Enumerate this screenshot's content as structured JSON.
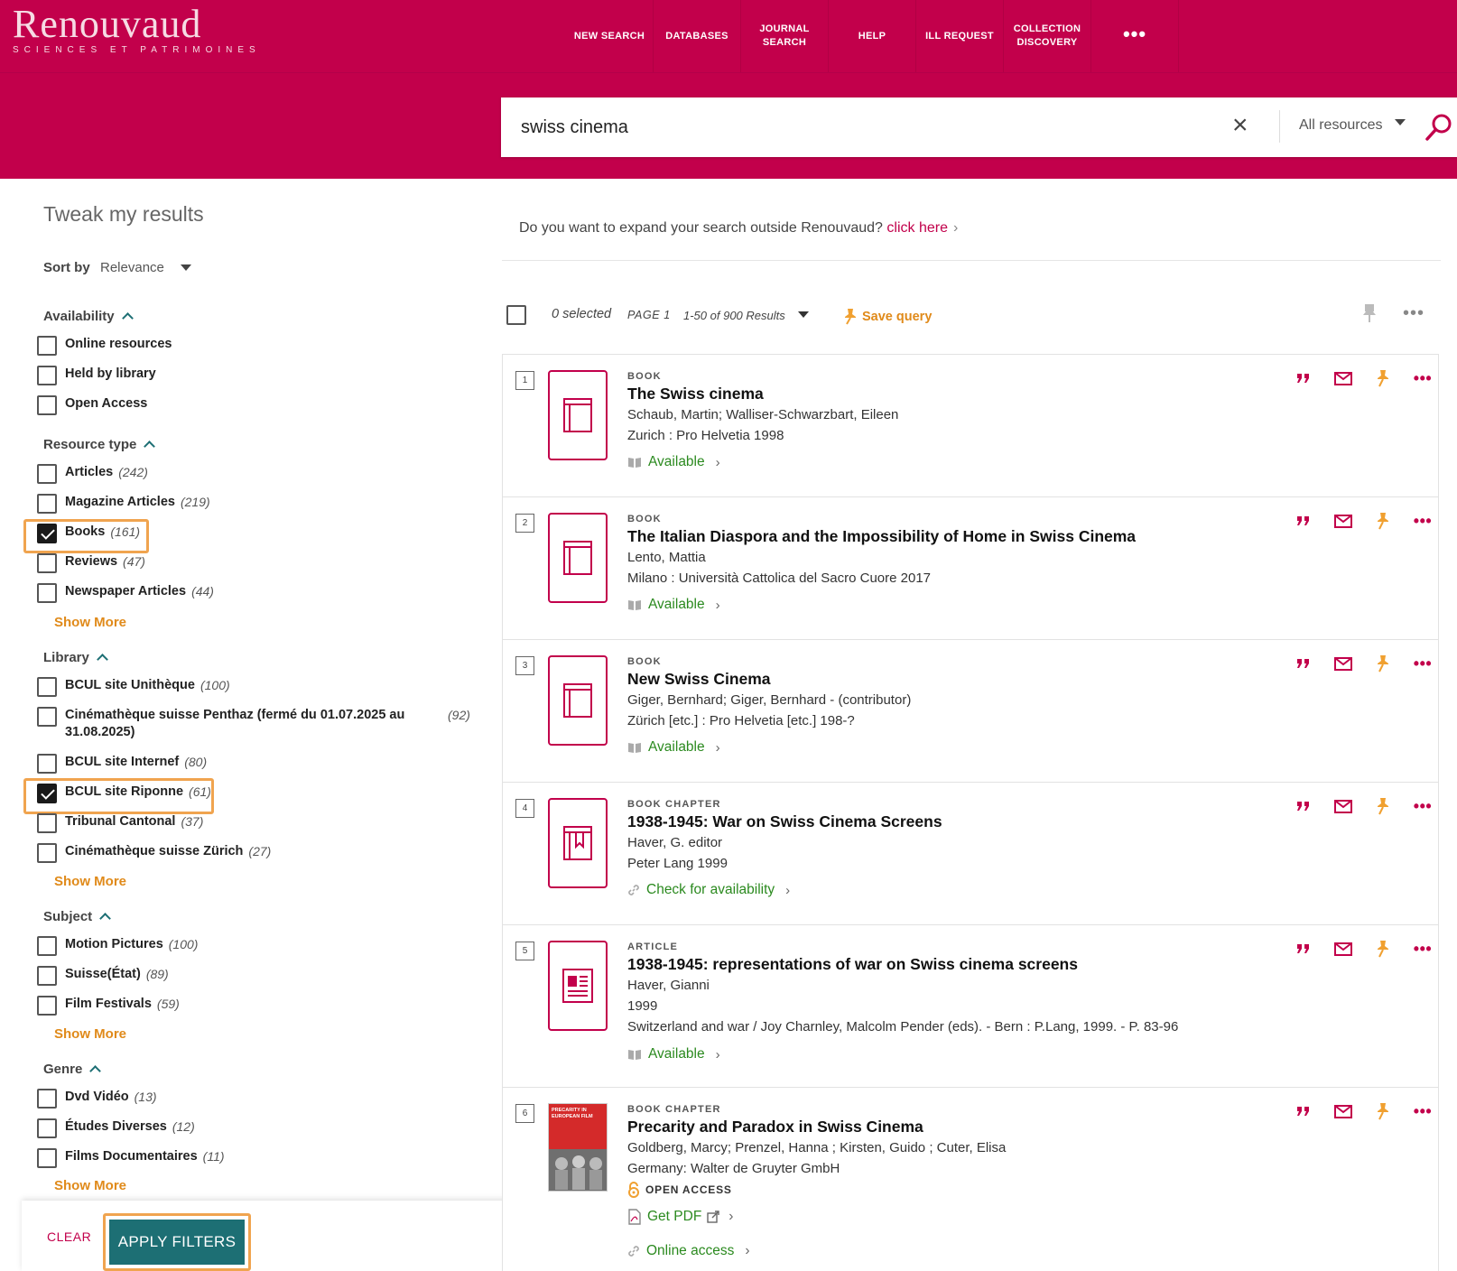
{
  "header": {
    "logo_main": "Renouvaud",
    "logo_sub": "SCIENCES ET PATRIMOINES",
    "nav": [
      {
        "label": "NEW SEARCH"
      },
      {
        "label": "DATABASES"
      },
      {
        "label": "JOURNAL SEARCH"
      },
      {
        "label": "HELP"
      },
      {
        "label": "ILL REQUEST"
      },
      {
        "label": "COLLECTION DISCOVERY"
      },
      {
        "label": "•••"
      }
    ],
    "brand_color": "#c2004b"
  },
  "search": {
    "query": "swiss cinema",
    "clear_icon": "×",
    "scope": "All resources"
  },
  "sidebar": {
    "title": "Tweak my results",
    "sort_label": "Sort by",
    "sort_value": "Relevance",
    "facets": {
      "availability": {
        "heading": "Availability",
        "options": [
          {
            "label": "Online resources",
            "count": "",
            "checked": false
          },
          {
            "label": "Held by library",
            "count": "",
            "checked": false
          },
          {
            "label": "Open Access",
            "count": "",
            "checked": false
          }
        ]
      },
      "resource_type": {
        "heading": "Resource type",
        "options": [
          {
            "label": "Articles",
            "count": "(242)",
            "checked": false
          },
          {
            "label": "Magazine Articles",
            "count": "(219)",
            "checked": false
          },
          {
            "label": "Books",
            "count": "(161)",
            "checked": true
          },
          {
            "label": "Reviews",
            "count": "(47)",
            "checked": false
          },
          {
            "label": "Newspaper Articles",
            "count": "(44)",
            "checked": false
          }
        ],
        "show_more": "Show More"
      },
      "library": {
        "heading": "Library",
        "options": [
          {
            "label": "BCUL site Unithèque",
            "count": "(100)",
            "checked": false
          },
          {
            "label": "Cinémathèque suisse Penthaz (fermé du 01.07.2025 au 31.08.2025)",
            "count": "(92)",
            "checked": false
          },
          {
            "label": "BCUL site Internef",
            "count": "(80)",
            "checked": false
          },
          {
            "label": "BCUL site Riponne",
            "count": "(61)",
            "checked": true
          },
          {
            "label": "Tribunal Cantonal",
            "count": "(37)",
            "checked": false
          },
          {
            "label": "Cinémathèque suisse Zürich",
            "count": "(27)",
            "checked": false
          }
        ],
        "show_more": "Show More"
      },
      "subject": {
        "heading": "Subject",
        "options": [
          {
            "label": "Motion Pictures",
            "count": "(100)",
            "checked": false
          },
          {
            "label": "Suisse(État)",
            "count": "(89)",
            "checked": false
          },
          {
            "label": "Film Festivals",
            "count": "(59)",
            "checked": false
          }
        ],
        "show_more": "Show More"
      },
      "genre": {
        "heading": "Genre",
        "options": [
          {
            "label": "Dvd Vidéo",
            "count": "(13)",
            "checked": false
          },
          {
            "label": "Études Diverses",
            "count": "(12)",
            "checked": false
          },
          {
            "label": "Films Documentaires",
            "count": "(11)",
            "checked": false
          }
        ],
        "show_more": "Show More"
      }
    },
    "clear_label": "CLEAR",
    "apply_label": "APPLY FILTERS"
  },
  "main": {
    "expand_text": "Do you want to expand your search outside Renouvaud?",
    "expand_link": "click here",
    "toolbar": {
      "selected": "0 selected",
      "page": "PAGE 1",
      "results": "1-50 of 900 Results",
      "save_query": "Save query"
    },
    "results": [
      {
        "num": "1",
        "type": "BOOK",
        "title": "The Swiss cinema",
        "line1": "Schaub, Martin; Walliser-Schwarzbart, Eileen",
        "line2": "Zurich : Pro Helvetia 1998",
        "line3": "",
        "availability": "Available",
        "icon": "book-icon"
      },
      {
        "num": "2",
        "type": "BOOK",
        "title": "The Italian Diaspora and the Impossibility of Home in Swiss Cinema",
        "line1": "Lento, Mattia",
        "line2": "Milano : Università Cattolica del Sacro Cuore 2017",
        "line3": "",
        "availability": "Available",
        "icon": "book-icon"
      },
      {
        "num": "3",
        "type": "BOOK",
        "title": "New Swiss Cinema",
        "line1": "Giger, Bernhard; Giger, Bernhard - (contributor)",
        "line2": "Zürich [etc.] : Pro Helvetia [etc.] 198-?",
        "line3": "",
        "availability": "Available",
        "icon": "book-icon"
      },
      {
        "num": "4",
        "type": "BOOK CHAPTER",
        "title": "1938-1945: War on Swiss Cinema Screens",
        "line1": "Haver, G. editor",
        "line2": "Peter Lang 1999",
        "line3": "",
        "availability": "Check for availability",
        "icon": "book-chapter-icon"
      },
      {
        "num": "5",
        "type": "ARTICLE",
        "title": "1938-1945: representations of war on Swiss cinema screens",
        "line1": "Haver, Gianni",
        "line2": "1999",
        "line3": "Switzerland and war / Joy Charnley, Malcolm Pender (eds). - Bern : P.Lang, 1999. - P. 83-96",
        "availability": "Available",
        "icon": "article-icon"
      },
      {
        "num": "6",
        "type": "BOOK CHAPTER",
        "title": "Precarity and Paradox in Swiss Cinema",
        "line1": "Goldberg, Marcy; Prenzel, Hanna ; Kirsten, Guido ; Cuter, Elisa",
        "line2": "Germany: Walter de Gruyter GmbH",
        "line3": "",
        "open_access": "OPEN ACCESS",
        "pdf": "Get PDF",
        "online": "Online access",
        "cover_title": "PRECARITY IN EUROPEAN FILM",
        "icon": "cover-image"
      }
    ]
  }
}
